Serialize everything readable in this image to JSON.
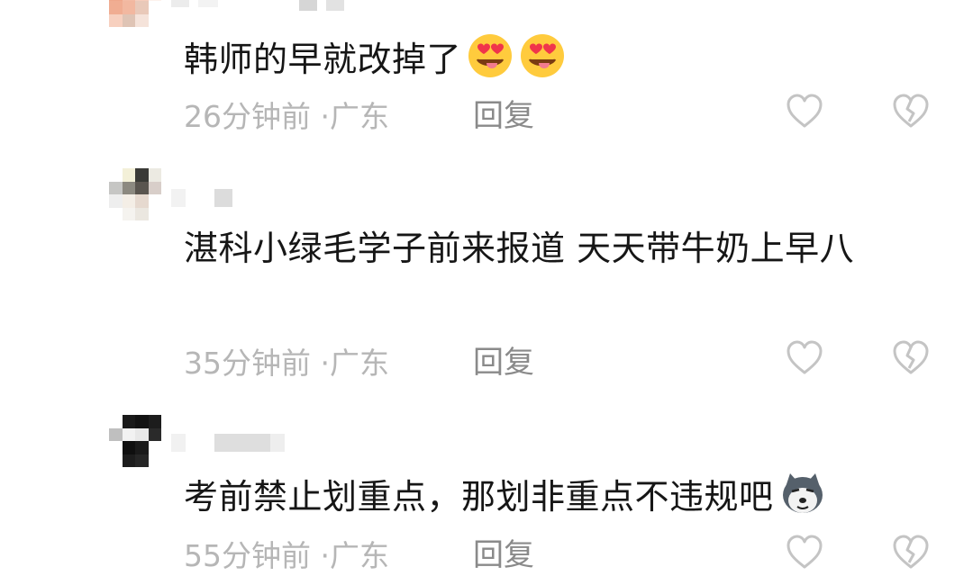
{
  "comments": [
    {
      "text": "韩师的早就改掉了",
      "time": "26分钟前",
      "location": "广东",
      "reply_label": "回复",
      "emojis": [
        "heart-eyes-tongue-emoji",
        "heart-eyes-tongue-emoji"
      ]
    },
    {
      "text": "湛科小绿毛学子前来报道 天天带牛奶上早八",
      "time": "35分钟前",
      "location": "广东",
      "reply_label": "回复",
      "emojis": []
    },
    {
      "text": "考前禁止划重点，那划非重点不违规吧",
      "time": "55分钟前",
      "location": "广东",
      "reply_label": "回复",
      "emojis": [
        "husky-dog-emoji"
      ]
    }
  ],
  "meta_separator": "·",
  "icons": {
    "like": "heart-outline-icon",
    "dislike": "broken-heart-icon"
  },
  "colors": {
    "text": "#161616",
    "meta": "#b6b6b6",
    "reply": "#8a8a8a",
    "icon": "#c4c4c4"
  }
}
